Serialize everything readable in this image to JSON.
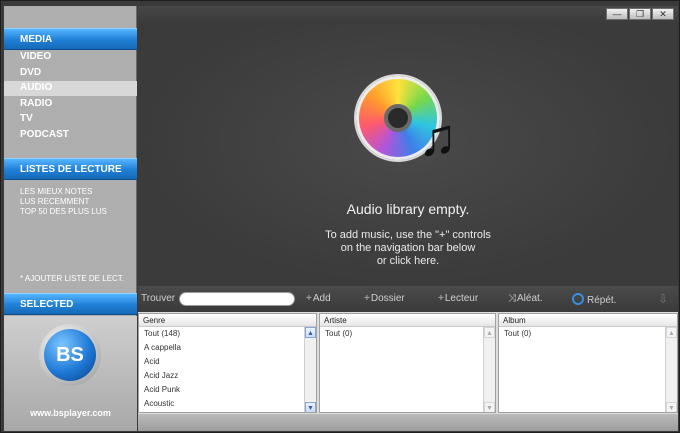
{
  "sidebar": {
    "media_header": "MEDIA",
    "items": [
      "VIDEO",
      "DVD",
      "AUDIO",
      "RADIO",
      "TV",
      "PODCAST"
    ],
    "active_item": "AUDIO",
    "playlists_header": "LISTES DE LECTURE",
    "playlists": [
      "LES MIEUX NOTES",
      "LUS RECEMMENT",
      "TOP 50 DES PLUS LUS"
    ],
    "add_playlist": "* AJOUTER LISTE DE LECT.",
    "selected_header": "SELECTED",
    "logo_text": "BS",
    "url": "www.bsplayer.com"
  },
  "window_controls": {
    "minimize": "—",
    "restore": "❐",
    "close": "✕"
  },
  "main": {
    "empty_title": "Audio library empty.",
    "hint_lines": [
      "To add music, use the \"+\" controls",
      "on the navigation bar below",
      "or click here."
    ]
  },
  "toolbar": {
    "search_label": "Trouver",
    "add": "Add",
    "folder": "Dossier",
    "drive": "Lecteur",
    "shuffle": "Aléat.",
    "repeat": "Répét."
  },
  "library": {
    "genre": {
      "header": "Genre",
      "items": [
        "Tout (148)",
        "A cappella",
        "Acid",
        "Acid Jazz",
        "Acid Punk",
        "Acoustic"
      ]
    },
    "artist": {
      "header": "Artiste",
      "items": [
        "Tout (0)"
      ]
    },
    "album": {
      "header": "Album",
      "items": [
        "Tout (0)"
      ]
    }
  },
  "colors": {
    "accent": "#1f7fd6",
    "active_item": "#d8d8d8"
  },
  "icons": [
    "cd-music-icon",
    "add-icon",
    "folder-icon",
    "drive-icon",
    "shuffle-icon",
    "repeat-icon",
    "scroll-down-icon"
  ]
}
